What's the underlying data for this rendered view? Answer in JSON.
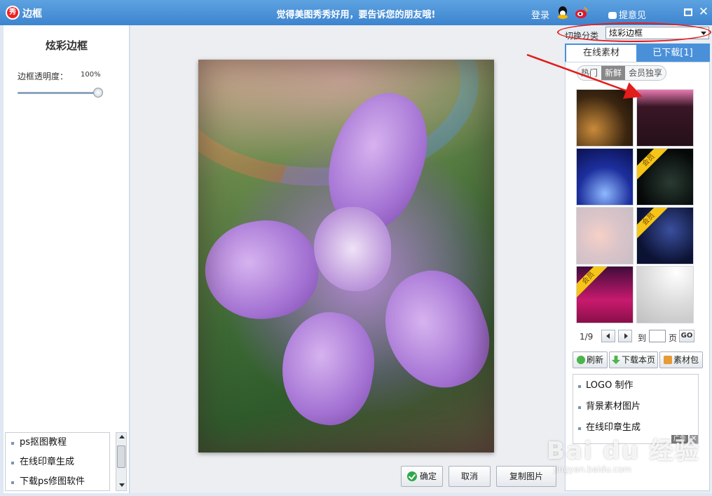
{
  "window": {
    "app_icon_text": "秀",
    "title": "边框",
    "slogan": "觉得美图秀秀好用，要告诉您的朋友哦!",
    "login": "登录",
    "feedback": "提意见",
    "close_glyph": "✕"
  },
  "left_panel": {
    "title": "炫彩边框",
    "opacity_label": "边框透明度：",
    "opacity_value": "100%",
    "opacity_percent": 100,
    "ad_items": [
      "ps抠图教程",
      "在线印章生成",
      "下载ps修图软件"
    ]
  },
  "actions": {
    "ok": "确定",
    "cancel": "取消",
    "copy": "复制图片"
  },
  "right_panel": {
    "category_label": "切换分类",
    "category_value": "炫彩边框",
    "tabs": [
      "在线素材",
      "已下载[1]"
    ],
    "subtabs": [
      "热门",
      "新鲜",
      "会员独享"
    ],
    "active_subtab": 1,
    "member_badge": "会员",
    "page_indicator": "1/9",
    "goto_label": "到",
    "page_unit": "页",
    "go_label": "GO",
    "refresh_label": "刷新",
    "download_page_label": "下载本页",
    "package_label": "素材包",
    "ad_items": [
      "LOGO 制作",
      "背景素材图片",
      "在线印章生成"
    ],
    "ad_tag": "广告",
    "ad_close": "✕"
  },
  "watermark": {
    "text": "Bai du 经验",
    "url": "jingyan.baidu.com"
  },
  "colors": {
    "titlebar": "#3d84cf",
    "annotation": "#e31c1c",
    "tab_active": "#4a90d9",
    "badge": "#f5c518"
  }
}
